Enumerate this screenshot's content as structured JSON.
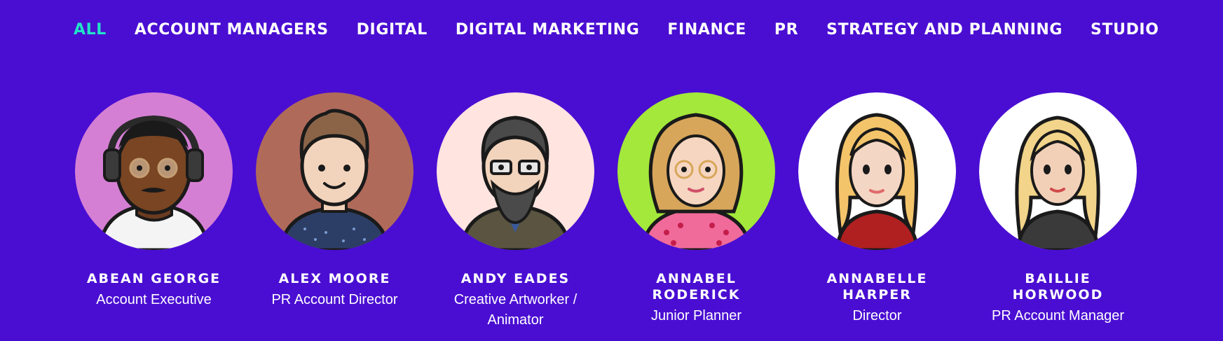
{
  "filters": [
    {
      "label": "ALL",
      "active": true
    },
    {
      "label": "ACCOUNT MANAGERS",
      "active": false
    },
    {
      "label": "DIGITAL",
      "active": false
    },
    {
      "label": "DIGITAL MARKETING",
      "active": false
    },
    {
      "label": "FINANCE",
      "active": false
    },
    {
      "label": "PR",
      "active": false
    },
    {
      "label": "STRATEGY AND PLANNING",
      "active": false
    },
    {
      "label": "STUDIO",
      "active": false
    }
  ],
  "team": [
    {
      "name": "ABEAN GEORGE",
      "role": "Account Executive",
      "avatar_bg": "#d57fd4",
      "avatar_icon": "avatar-headphones-icon"
    },
    {
      "name": "ALEX MOORE",
      "role": "PR Account Director",
      "avatar_bg": "#b06a5a",
      "avatar_icon": "avatar-quiff-icon"
    },
    {
      "name": "ANDY EADES",
      "role": "Creative Artworker / Animator",
      "avatar_bg": "#ffe4e0",
      "avatar_icon": "avatar-beard-glasses-icon"
    },
    {
      "name": "ANNABEL RODERICK",
      "role": "Junior Planner",
      "avatar_bg": "#a3e83a",
      "avatar_icon": "avatar-curly-hair-icon"
    },
    {
      "name": "ANNABELLE HARPER",
      "role": "Director",
      "avatar_bg": "#ffffff",
      "avatar_icon": "avatar-long-hair-icon"
    },
    {
      "name": "BAILLIE HORWOOD",
      "role": "PR Account Manager",
      "avatar_bg": "#ffffff",
      "avatar_icon": "avatar-blonde-hair-icon"
    }
  ],
  "colors": {
    "background": "#4a0ed2",
    "accent": "#21e3c7",
    "text": "#ffffff"
  }
}
